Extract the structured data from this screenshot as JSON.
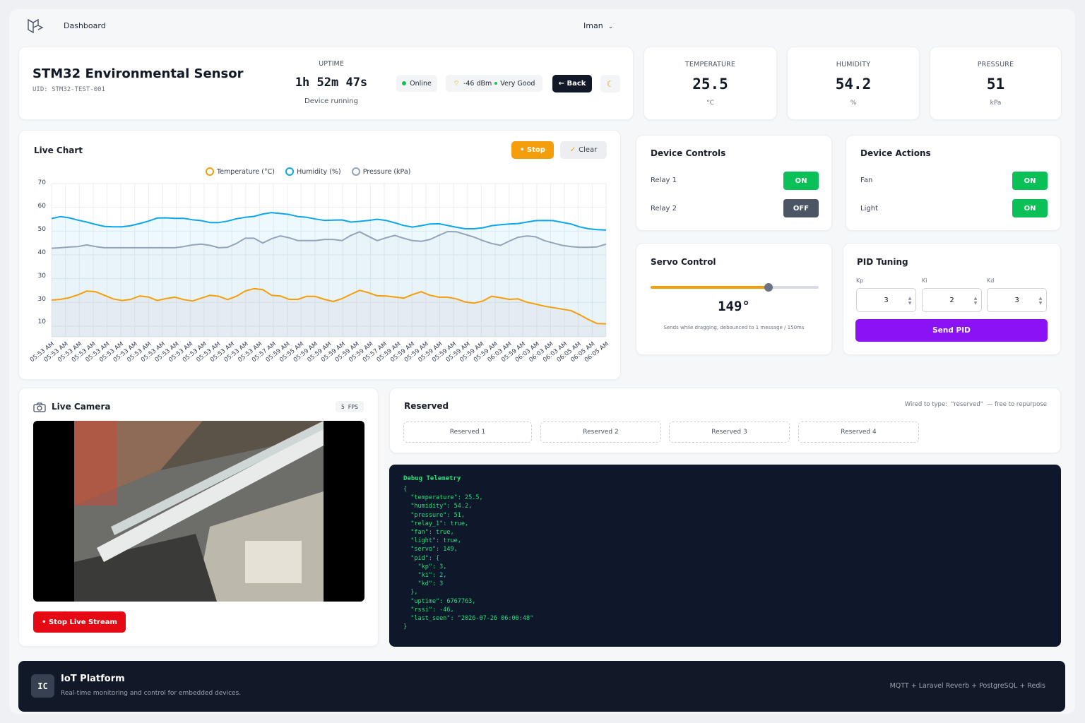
{
  "nav": {
    "title": "Dashboard",
    "user": "Iman"
  },
  "device": {
    "name": "STM32 Environmental Sensor",
    "uid": "UID: STM32-TEST-001",
    "uptime_label": "UPTIME",
    "uptime": "1h 52m 47s",
    "uptime_status": "Device running",
    "status": "Online",
    "signal": "-46 dBm",
    "signal_quality": "Very Good",
    "back_label": "← Back"
  },
  "metrics": [
    {
      "label": "TEMPERATURE",
      "value": "25.5",
      "unit": "°C"
    },
    {
      "label": "HUMIDITY",
      "value": "54.2",
      "unit": "%"
    },
    {
      "label": "PRESSURE",
      "value": "51",
      "unit": "kPa"
    }
  ],
  "chart_card": {
    "title": "Live Chart",
    "stop_label": "• Stop",
    "clear_label": "Clear"
  },
  "chart_data": {
    "type": "line",
    "ylim": [
      0,
      70
    ],
    "yticks": [
      10,
      20,
      30,
      40,
      50,
      60,
      70
    ],
    "ytick_labels": [
      "10",
      "30",
      "30",
      "40",
      "50",
      "60",
      "70"
    ],
    "x": [
      "05:53 AM",
      "05:53 AM",
      "05:53 AM",
      "05:53 AM",
      "05:53 AM",
      "05:53 AM",
      "05:53 AM",
      "05:53 AM",
      "05:53 AM",
      "05:53 AM",
      "05:53 AM",
      "05:53 AM",
      "05:53 AM",
      "05:53 AM",
      "05:53 AM",
      "05:53 AM",
      "05:57 AM",
      "05:59 AM",
      "05:55 AM",
      "05:59 AM",
      "05:59 AM",
      "05:59 AM",
      "05:59 AM",
      "05:59 AM",
      "05:57 AM",
      "05:59 AM",
      "05:59 AM",
      "05:59 AM",
      "05:59 AM",
      "05:59 AM",
      "05:59 AM",
      "05:59 AM",
      "05:59 AM",
      "06:03 AM",
      "05:59 AM",
      "06:03 AM",
      "06:03 AM",
      "06:03 AM",
      "06:05 AM",
      "06:05 AM",
      "06:05 AM"
    ],
    "series": [
      {
        "name": "Temperature (°C)",
        "color": "#f59e0b",
        "values": [
          21,
          21.3,
          22,
          23.2,
          24.8,
          24.5,
          23,
          21.5,
          20.8,
          21.3,
          22.7,
          22.3,
          20.8,
          21.6,
          22.2,
          21.2,
          20.6,
          21.8,
          23,
          22.6,
          21.2,
          22.6,
          24.8,
          25.8,
          25.4,
          23,
          22.7,
          21.3,
          21.3,
          22.6,
          22.5,
          21.3,
          20.4,
          21.6,
          23.4,
          25.1,
          24.1,
          22.8,
          22.7,
          22.3,
          21.8,
          23.3,
          24.5,
          23,
          22.2,
          22.2,
          21.5,
          20.2,
          19.7,
          20.6,
          22.6,
          22,
          21.3,
          21.5,
          20.1,
          19.3,
          18.4,
          17.8,
          17.2,
          16.6,
          14.8,
          12.8,
          11.1,
          11
        ]
      },
      {
        "name": "Humidity (%)",
        "color": "#0ea5e9",
        "values": [
          55.3,
          56.1,
          55.6,
          54.6,
          53.8,
          52.8,
          52,
          51.8,
          51.8,
          52.3,
          53.2,
          54.2,
          55.5,
          55.6,
          55.4,
          55.4,
          54.8,
          54.4,
          53.6,
          53.6,
          54.2,
          55.2,
          55.8,
          56.2,
          57.2,
          57.8,
          57.4,
          57,
          56.1,
          55.8,
          55.1,
          54.5,
          54.6,
          54.7,
          53.8,
          54.1,
          54.5,
          55,
          54.5,
          53.5,
          52.4,
          51.7,
          52.3,
          53,
          53.1,
          52.4,
          51.6,
          51,
          51,
          51.4,
          52.3,
          52.7,
          53,
          53.2,
          53.8,
          54.4,
          54.5,
          54.4,
          53.7,
          53,
          51.8,
          51,
          50.6,
          50.5
        ]
      },
      {
        "name": "Pressure (kPa)",
        "color": "#94a3b8",
        "values": [
          42.8,
          43,
          43.3,
          43.5,
          44.2,
          43.5,
          43,
          43,
          43,
          43,
          43,
          43,
          43,
          43,
          43,
          43.5,
          44.2,
          44.5,
          44,
          43,
          43.2,
          44.8,
          47,
          47,
          45,
          46.8,
          48,
          47.2,
          46,
          46,
          46,
          46.5,
          46.5,
          46,
          48.2,
          49.7,
          47.8,
          46,
          47.2,
          48.2,
          47,
          46,
          45.7,
          46.5,
          48.2,
          49.8,
          49.7,
          48.6,
          47.5,
          46,
          44.8,
          44,
          45.8,
          47.4,
          48,
          47.6,
          46,
          45,
          44,
          43.5,
          43.2,
          43.2,
          43.4,
          44.5
        ]
      }
    ]
  },
  "controls": {
    "title": "Device Controls",
    "items": [
      {
        "label": "Relay 1",
        "state": "ON"
      },
      {
        "label": "Relay 2",
        "state": "OFF"
      }
    ]
  },
  "actions": {
    "title": "Device Actions",
    "items": [
      {
        "label": "Fan",
        "state": "ON"
      },
      {
        "label": "Light",
        "state": "ON"
      }
    ]
  },
  "servo": {
    "title": "Servo Control",
    "value": "149°",
    "position_fraction": 0.7,
    "note": "Sends while dragging, debounced to 1 message / 150ms"
  },
  "pid": {
    "title": "PID Tuning",
    "kp_label": "Kp",
    "kp": "3",
    "ki_label": "Ki",
    "ki": "2",
    "kd_label": "Kd",
    "kd": "3",
    "send_label": "Send PID"
  },
  "camera": {
    "title": "Live Camera",
    "fps": "5 FPS",
    "stop_label": "• Stop Live Stream"
  },
  "reserved": {
    "title": "Reserved",
    "note": "Wired to type:  \"reserved\"  — free to repurpose",
    "items": [
      "Reserved 1",
      "Reserved 2",
      "Reserved 3",
      "Reserved 4"
    ]
  },
  "debug": {
    "title": "Debug Telemetry",
    "json": "{\n  \"temperature\": 25.5,\n  \"humidity\": 54.2,\n  \"pressure\": 51,\n  \"relay_1\": true,\n  \"fan\": true,\n  \"light\": true,\n  \"servo\": 149,\n  \"pid\": {\n    \"kp\": 3,\n    \"ki\": 2,\n    \"kd\": 3\n  },\n  \"uptime\": 6767763,\n  \"rssi\": -46,\n  \"last_seen\": \"2026-07-26 06:00:48\"\n}"
  },
  "footer": {
    "badge": "IC",
    "title": "IoT Platform",
    "subtitle": "Real-time monitoring and control for embedded devices.",
    "stack": "MQTT + Laravel Reverb + PostgreSQL + Redis"
  },
  "colors": {
    "primary_dark": "#111827",
    "accent_orange": "#f59e0b",
    "success": "#0cc058",
    "purple": "#8b12f5",
    "danger": "#e50914"
  }
}
